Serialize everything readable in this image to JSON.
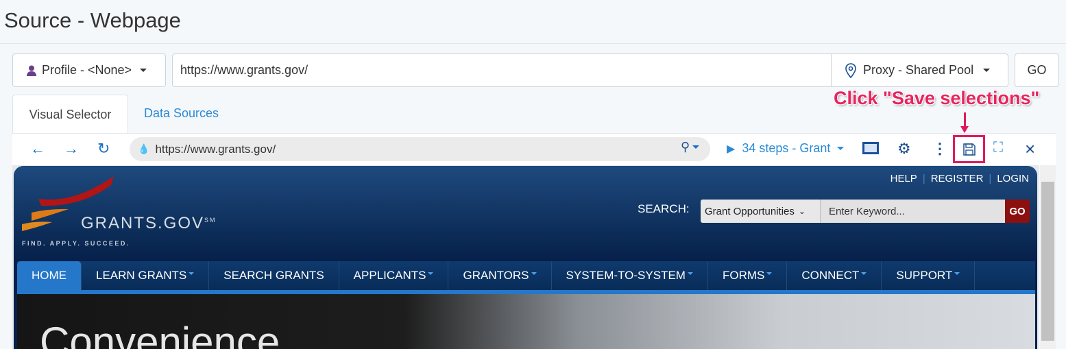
{
  "page_title": "Source - Webpage",
  "profile": {
    "label": "Profile -  <None>"
  },
  "url_input": {
    "value": "https://www.grants.gov/"
  },
  "proxy": {
    "label": "Proxy -  Shared Pool"
  },
  "go_label": "GO",
  "tabs": [
    {
      "label": "Visual Selector",
      "active": true
    },
    {
      "label": "Data Sources",
      "active": false
    }
  ],
  "browser": {
    "address": "https://www.grants.gov/",
    "steps_label": "34 steps - Grant",
    "icons": [
      "back-icon",
      "forward-icon",
      "reload-icon",
      "location-pin-icon",
      "play-icon",
      "select-element-icon",
      "gear-icon",
      "more-vertical-icon",
      "save-icon",
      "fullscreen-icon",
      "close-icon"
    ]
  },
  "annotation": {
    "text": "Click \"Save selections\"",
    "color": "#e8245e"
  },
  "site": {
    "top_links": [
      "HELP",
      "REGISTER",
      "LOGIN"
    ],
    "search_label": "SEARCH:",
    "search_select": "Grant Opportunities",
    "search_placeholder": "Enter Keyword...",
    "search_go": "GO",
    "logo_text": "GRANTS.GOV",
    "logo_mark": "SM",
    "tagline": "FIND. APPLY. SUCCEED.",
    "nav": [
      {
        "label": "HOME",
        "dropdown": false,
        "active": true
      },
      {
        "label": "LEARN GRANTS",
        "dropdown": true
      },
      {
        "label": "SEARCH GRANTS",
        "dropdown": false
      },
      {
        "label": "APPLICANTS",
        "dropdown": true
      },
      {
        "label": "GRANTORS",
        "dropdown": true
      },
      {
        "label": "SYSTEM-TO-SYSTEM",
        "dropdown": true
      },
      {
        "label": "FORMS",
        "dropdown": true
      },
      {
        "label": "CONNECT",
        "dropdown": true
      },
      {
        "label": "SUPPORT",
        "dropdown": true
      }
    ],
    "hero_title": "Convenience"
  }
}
